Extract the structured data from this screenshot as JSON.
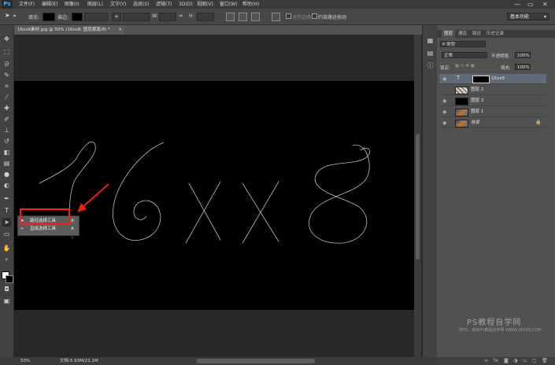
{
  "app": {
    "logo": "Ps"
  },
  "menu": [
    "文件(F)",
    "编辑(E)",
    "图像(I)",
    "图层(L)",
    "文字(Y)",
    "选择(S)",
    "滤镜(T)",
    "3D(D)",
    "视图(V)",
    "窗口(W)",
    "帮助(H)"
  ],
  "window_controls": {
    "minimize": "—",
    "restore": "▭",
    "close": "✕"
  },
  "options": {
    "fill_label": "填充:",
    "stroke_label": "描边:",
    "w_label": "W:",
    "h_label": "H:",
    "align_edges": "对齐边缘",
    "constrain_path": "约束路径拖动",
    "workspace": "基本功能"
  },
  "document": {
    "tab_title": "16xx8素材.jpg @ 50% (16xx8, 图层蒙版/8) *",
    "zoom": "50%",
    "doc_info": "文档:5.93M/21.1M"
  },
  "flyout": {
    "items": [
      {
        "label": "路径选择工具",
        "shortcut": "A"
      },
      {
        "label": "直接选择工具",
        "shortcut": "A"
      }
    ]
  },
  "canvas_text": "16xx8",
  "panels": {
    "tabs": [
      "图层",
      "通道",
      "路径",
      "历史记录"
    ],
    "kind_label": "P 类型",
    "blend_mode": "正常",
    "opacity_label": "不透明度:",
    "opacity_value": "100%",
    "lock_label": "锁定:",
    "fill_label": "填充:",
    "fill_value": "100%",
    "layers": [
      {
        "name": "16xx8",
        "type": "text",
        "selected": true,
        "visible": true
      },
      {
        "name": "图层 2",
        "type": "pattern",
        "selected": false,
        "visible": false
      },
      {
        "name": "图层 3",
        "type": "black",
        "selected": false,
        "visible": true
      },
      {
        "name": "图层 1",
        "type": "photo",
        "selected": false,
        "visible": true
      },
      {
        "name": "背景",
        "type": "photo",
        "selected": false,
        "visible": true,
        "locked": true
      }
    ]
  },
  "watermark": {
    "title": "PS教程自学网",
    "subtitle": "学PS，就到PS教程自学网 WWW.16XX8.COM"
  },
  "colors": {
    "highlight": "#ff1a1a",
    "arrow": "#e52020",
    "selected_layer": "#5f6b7a"
  }
}
